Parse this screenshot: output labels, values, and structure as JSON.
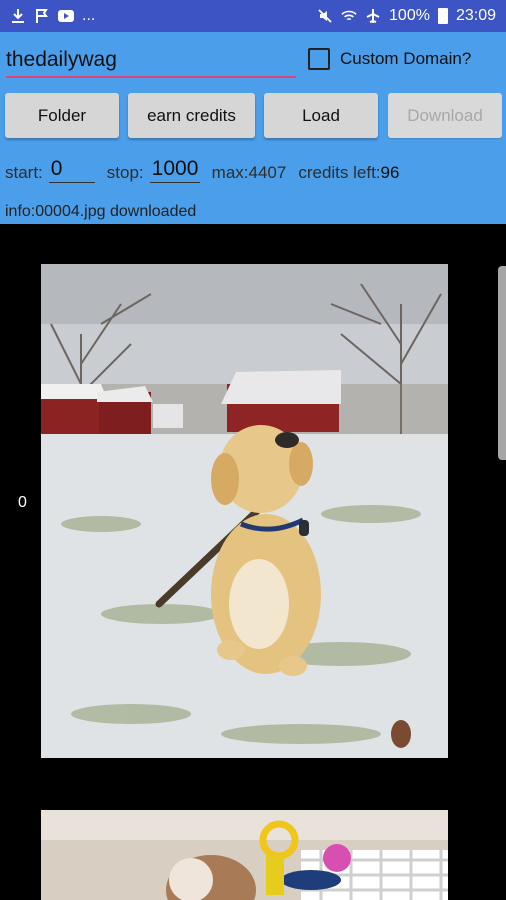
{
  "status_bar": {
    "left_icons": [
      "download-icon",
      "flag-icon",
      "youtube-icon"
    ],
    "more": "...",
    "right_icons": [
      "mute-icon",
      "wifi-icon",
      "airplane-icon",
      "battery-icon"
    ],
    "battery": "100%",
    "time": "23:09"
  },
  "form": {
    "username_value": "thedailywag",
    "custom_domain_label": "Custom Domain?",
    "custom_domain_checked": false
  },
  "toolbar": {
    "folder_label": "Folder",
    "earn_credits_label": "earn credits",
    "load_label": "Load",
    "download_label": "Download"
  },
  "stats": {
    "start_label": "start:",
    "start_value": "0",
    "stop_label": "stop:",
    "stop_value": "1000",
    "max_label": "max:",
    "max_value": "4407",
    "credits_label": "credits left:",
    "credits_value": "96"
  },
  "info_text": "info:00004.jpg downloaded",
  "gallery": {
    "row_index": "0"
  },
  "colors": {
    "status_bar": "#3d55c4",
    "panel": "#4b9eea",
    "accent_underline": "#e0427a"
  }
}
